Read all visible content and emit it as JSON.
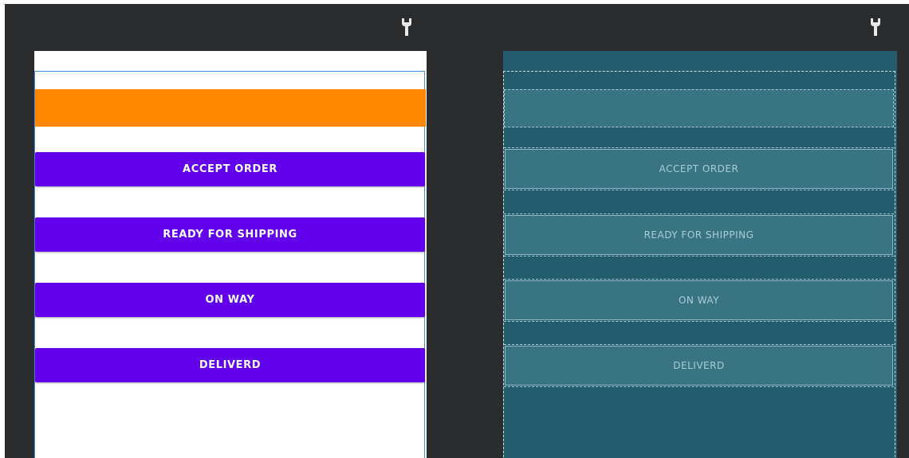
{
  "toolbar": {
    "design_tool_icon": "wrench-icon",
    "blueprint_tool_icon": "wrench-icon"
  },
  "colors": {
    "editor_background": "#2b2c2e",
    "header_bar": "#ff8800",
    "button_primary": "#6200ee",
    "button_text": "#ffffff",
    "blueprint_background": "#235c6c",
    "blueprint_element": "#397483",
    "blueprint_text": "#a9cdd5",
    "selection_outline": "#4a90e2"
  },
  "design": {
    "buttons": [
      {
        "label": "ACCEPT ORDER"
      },
      {
        "label": "READY FOR SHIPPING"
      },
      {
        "label": "ON WAY"
      },
      {
        "label": "DELIVERD"
      }
    ]
  },
  "blueprint": {
    "buttons": [
      {
        "label": "ACCEPT ORDER"
      },
      {
        "label": "READY FOR SHIPPING"
      },
      {
        "label": "ON WAY"
      },
      {
        "label": "DELIVERD"
      }
    ]
  }
}
